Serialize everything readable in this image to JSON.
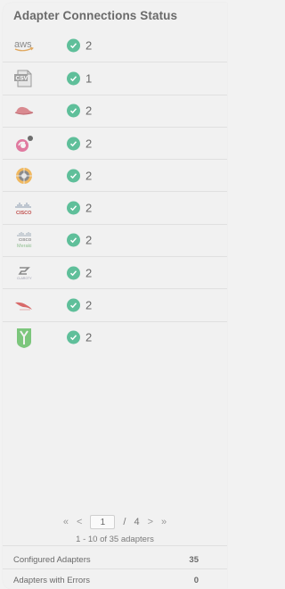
{
  "panel": {
    "title": "Adapter Connections Status"
  },
  "adapters": [
    {
      "logo_text": "aws",
      "icon": "aws-logo-icon",
      "count": "2"
    },
    {
      "logo_text": "CSV",
      "icon": "csv-file-icon",
      "count": "1"
    },
    {
      "logo_text": "",
      "icon": "hat-logo-icon",
      "count": "2"
    },
    {
      "logo_text": "",
      "icon": "swirl-logo-icon",
      "count": "2"
    },
    {
      "logo_text": "",
      "icon": "gear-globe-logo-icon",
      "count": "2"
    },
    {
      "logo_text": "CISCO",
      "icon": "cisco-logo-icon",
      "count": "2"
    },
    {
      "logo_text": "CISCO Meraki",
      "icon": "cisco-meraki-logo-icon",
      "count": "2"
    },
    {
      "logo_text": "CLAROTY",
      "icon": "claroty-logo-icon",
      "count": "2"
    },
    {
      "logo_text": "",
      "icon": "crowdstrike-logo-icon",
      "count": "2"
    },
    {
      "logo_text": "",
      "icon": "shield-logo-icon",
      "count": "2"
    }
  ],
  "status_icon": "check-circle-icon",
  "colors": {
    "check": "#5fbf9a"
  },
  "pagination": {
    "first": "«",
    "prev": "<",
    "current_page": "1",
    "separator": "/",
    "total_pages": "4",
    "next": ">",
    "last": "»",
    "range_text": "1 - 10 of 35 adapters"
  },
  "stats": {
    "configured_label": "Configured Adapters",
    "configured_value": "35",
    "errors_label": "Adapters with Errors",
    "errors_value": "0"
  }
}
